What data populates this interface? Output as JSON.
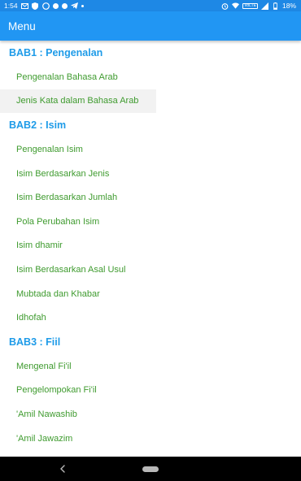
{
  "status_bar": {
    "time": "1:54",
    "battery": "18%",
    "lte": "VoLTE"
  },
  "app_bar": {
    "title": "Menu"
  },
  "sections": [
    {
      "title": "BAB1 : Pengenalan",
      "items": [
        "Pengenalan Bahasa Arab",
        "Jenis Kata dalam Bahasa Arab"
      ]
    },
    {
      "title": "BAB2 : Isim",
      "items": [
        "Pengenalan Isim",
        "Isim Berdasarkan Jenis",
        "Isim Berdasarkan Jumlah",
        "Pola Perubahan Isim",
        "Isim dhamir",
        "Isim Berdasarkan Asal Usul",
        "Mubtada dan Khabar",
        "Idhofah"
      ]
    },
    {
      "title": "BAB3 : Fiil",
      "items": [
        "Mengenal Fi'il",
        "Pengelompokan Fi'il",
        "'Amil Nawashib",
        "'Amil Jawazim"
      ]
    }
  ],
  "colors": {
    "status_bar": "#1e88e5",
    "app_bar": "#2196f3",
    "section_header": "#1e9be8",
    "menu_item": "#3f9b2f"
  }
}
